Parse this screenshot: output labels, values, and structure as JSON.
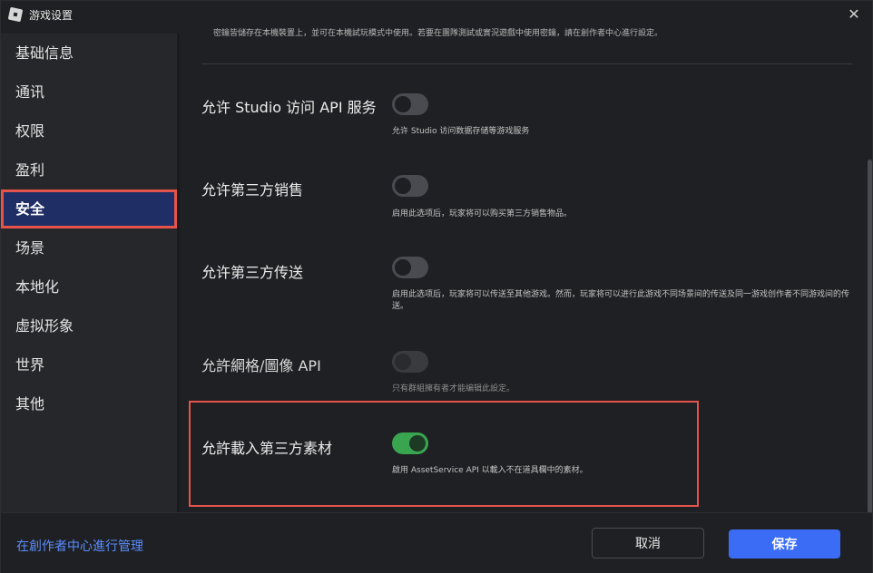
{
  "window": {
    "title": "游戏设置",
    "app_icon": "roblox-studio-logo",
    "close_icon": "close-icon"
  },
  "sidebar": {
    "items": [
      {
        "label": "基础信息",
        "active": false
      },
      {
        "label": "通讯",
        "active": false
      },
      {
        "label": "权限",
        "active": false
      },
      {
        "label": "盈利",
        "active": false
      },
      {
        "label": "安全",
        "active": true
      },
      {
        "label": "场景",
        "active": false
      },
      {
        "label": "本地化",
        "active": false
      },
      {
        "label": "虚拟形象",
        "active": false
      },
      {
        "label": "世界",
        "active": false
      },
      {
        "label": "其他",
        "active": false
      }
    ]
  },
  "main": {
    "top_desc": "密鑰皆儲存在本機裝置上，並可在本機試玩模式中使用。若要在團隊測試或實況遊戲中使用密鑰，請在創作者中心進行設定。",
    "settings": [
      {
        "label": "允许 Studio 访问 API 服务",
        "desc": "允许 Studio 访问数据存储等游戏服务",
        "state": "off"
      },
      {
        "label": "允许第三方销售",
        "desc": "启用此选项后，玩家将可以购买第三方销售物品。",
        "state": "off"
      },
      {
        "label": "允许第三方传送",
        "desc": "启用此选项后，玩家将可以传送至其他游戏。然而，玩家将可以进行此游戏不同场景间的传送及同一游戏创作者不同游戏间的传送。",
        "state": "off"
      },
      {
        "label": "允許網格/圖像 API",
        "desc": "只有群組擁有者才能编辑此設定。",
        "state": "disabled"
      },
      {
        "label": "允許載入第三方素材",
        "desc": "啟用 AssetService API 以載入不在道具欄中的素材。",
        "state": "on"
      }
    ]
  },
  "footer": {
    "manage_link": "在創作者中心進行管理",
    "cancel_label": "取消",
    "save_label": "保存"
  },
  "colors": {
    "accent": "#3a6cf5",
    "link": "#5a8dff",
    "toggle_on": "#3aa551",
    "highlight": "#e5534b",
    "sidebar_active": "#1f2f66"
  }
}
